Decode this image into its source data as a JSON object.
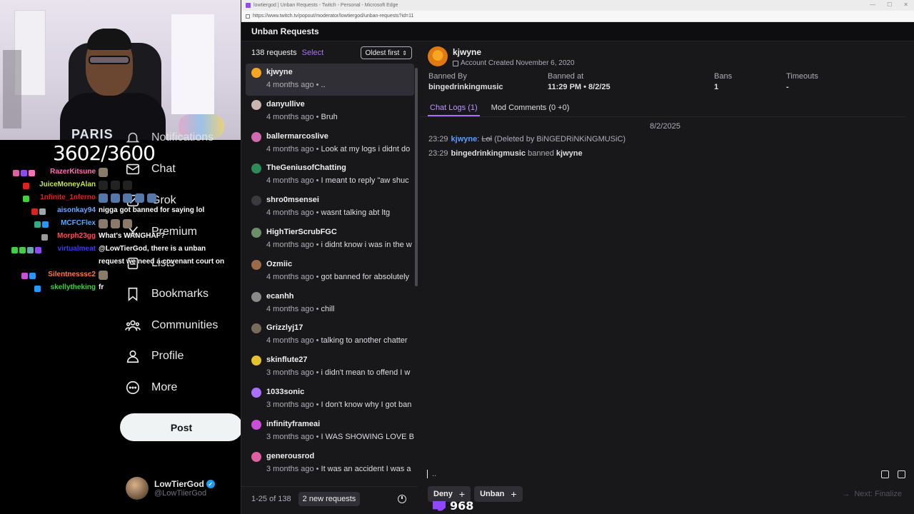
{
  "stream": {
    "counter": "3602/3600",
    "shirt_text": "PARIS",
    "x_nav": [
      {
        "label": "Notifications",
        "icon": "bell-icon"
      },
      {
        "label": "Chat",
        "icon": "mail-icon"
      },
      {
        "label": "Grok",
        "icon": "grok-icon"
      },
      {
        "label": "Premium",
        "icon": "x-logo-icon"
      },
      {
        "label": "Lists",
        "icon": "list-icon"
      },
      {
        "label": "Bookmarks",
        "icon": "bookmark-icon"
      },
      {
        "label": "Communities",
        "icon": "people-icon"
      },
      {
        "label": "Profile",
        "icon": "person-icon"
      },
      {
        "label": "More",
        "icon": "more-circle-icon"
      }
    ],
    "post_label": "Post",
    "profile": {
      "name": "LowTierGod",
      "handle": "@LowTiierGod"
    },
    "chat": [
      {
        "user": "RazerKitsune",
        "color": "#ff6fb5",
        "msg": ""
      },
      {
        "user": "JuiceMoneyAlan",
        "color": "#c8e64c",
        "msg": ""
      },
      {
        "user": "1nfinite_1nferno",
        "color": "#e02020",
        "msg": ""
      },
      {
        "user": "aisonkay94",
        "color": "#6aa6ff",
        "msg": "nigga got banned for saying lol"
      },
      {
        "user": "MCFCFlex",
        "color": "#5aa8ff",
        "msg": ""
      },
      {
        "user": "Morph23gg",
        "color": "#ff4f4f",
        "msg": "What's WANGHAF?"
      },
      {
        "user": "virtualmeat",
        "color": "#3a3af0",
        "msg": "@LowTierGod, there is a unban"
      },
      {
        "user": "",
        "color": "#ffffff",
        "msg": "request we need a covenant court on"
      },
      {
        "user": "Silentnesssc2",
        "color": "#ff7a3d",
        "msg": ""
      },
      {
        "user": "skellytheking",
        "color": "#3fd13f",
        "msg": "fr"
      }
    ],
    "bits": "968"
  },
  "browser": {
    "title": "lowtiergod | Unban Requests - Twitch - Personal - Microsoft Edge",
    "url": "https://www.twitch.tv/popout/moderator/lowtiergod/unban-requests?id=11",
    "modal_title": "Unban Requests"
  },
  "list": {
    "count": "138 requests",
    "select": "Select",
    "sort": "Oldest first",
    "items": [
      {
        "name": "kjwyne",
        "time": "4 months ago",
        "msg": "..",
        "avatar": "#f6a623"
      },
      {
        "name": "danyullive",
        "time": "4 months ago",
        "msg": "Bruh",
        "avatar": "#c9b6b0"
      },
      {
        "name": "ballermarcoslive",
        "time": "4 months ago",
        "msg": "Look at my logs i didnt do",
        "avatar": "#d06bb0"
      },
      {
        "name": "TheGeniusofChatting",
        "time": "4 months ago",
        "msg": "I meant to reply \"aw shuc",
        "avatar": "#2e8b57"
      },
      {
        "name": "shro0msensei",
        "time": "4 months ago",
        "msg": "wasnt talking abt ltg",
        "avatar": "#3a3a40"
      },
      {
        "name": "HighTierScrubFGC",
        "time": "4 months ago",
        "msg": "i didnt know i was in the w",
        "avatar": "#6b8e6b"
      },
      {
        "name": "Ozmiic",
        "time": "4 months ago",
        "msg": "got banned for absolutely",
        "avatar": "#9a6a4a"
      },
      {
        "name": "ecanhh",
        "time": "4 months ago",
        "msg": "chill",
        "avatar": "#8a8a8a"
      },
      {
        "name": "Grizzlyj17",
        "time": "4 months ago",
        "msg": "talking to another chatter",
        "avatar": "#7a6a5a"
      },
      {
        "name": "skinflute27",
        "time": "3 months ago",
        "msg": "i didn't mean to offend I w",
        "avatar": "#e6c230"
      },
      {
        "name": "1033sonic",
        "time": "3 months ago",
        "msg": "I don't know why I got ban",
        "avatar": "#a970ff"
      },
      {
        "name": "infinityframeai",
        "time": "3 months ago",
        "msg": "I WAS SHOWING LOVE BR",
        "avatar": "#c94fd6"
      },
      {
        "name": "generousrod",
        "time": "3 months ago",
        "msg": "It was an accident I was a",
        "avatar": "#e05fa0"
      }
    ],
    "range": "1-25 of 138",
    "new_requests": "2 new requests"
  },
  "detail": {
    "username": "kjwyne",
    "created": "Account Created November 6, 2020",
    "banned_by_label": "Banned By",
    "banned_by": "bingedrinkingmusic",
    "banned_at_label": "Banned at",
    "banned_at": "11:29 PM • 8/2/25",
    "bans_label": "Bans",
    "bans": "1",
    "timeouts_label": "Timeouts",
    "timeouts": "-",
    "tab_chat": "Chat Logs (1)",
    "tab_mod": "Mod Comments (0 +0)",
    "log_date": "8/2/2025",
    "log1": {
      "time": "23:29",
      "user": "kjwyne",
      "sep": ":",
      "msg": "Lol",
      "note": "(Deleted by BiNGEDRiNKiNGMUSiC)"
    },
    "log2": {
      "time": "23:29",
      "actor": "bingedrinkingmusic",
      "verb": "banned",
      "target": "kjwyne"
    },
    "comment": "..",
    "deny": "Deny",
    "unban": "Unban",
    "finalize": "Next: Finalize"
  },
  "colors": {
    "accent": "#a970ff",
    "link": "#5c9cff",
    "bg": "#18181b"
  }
}
